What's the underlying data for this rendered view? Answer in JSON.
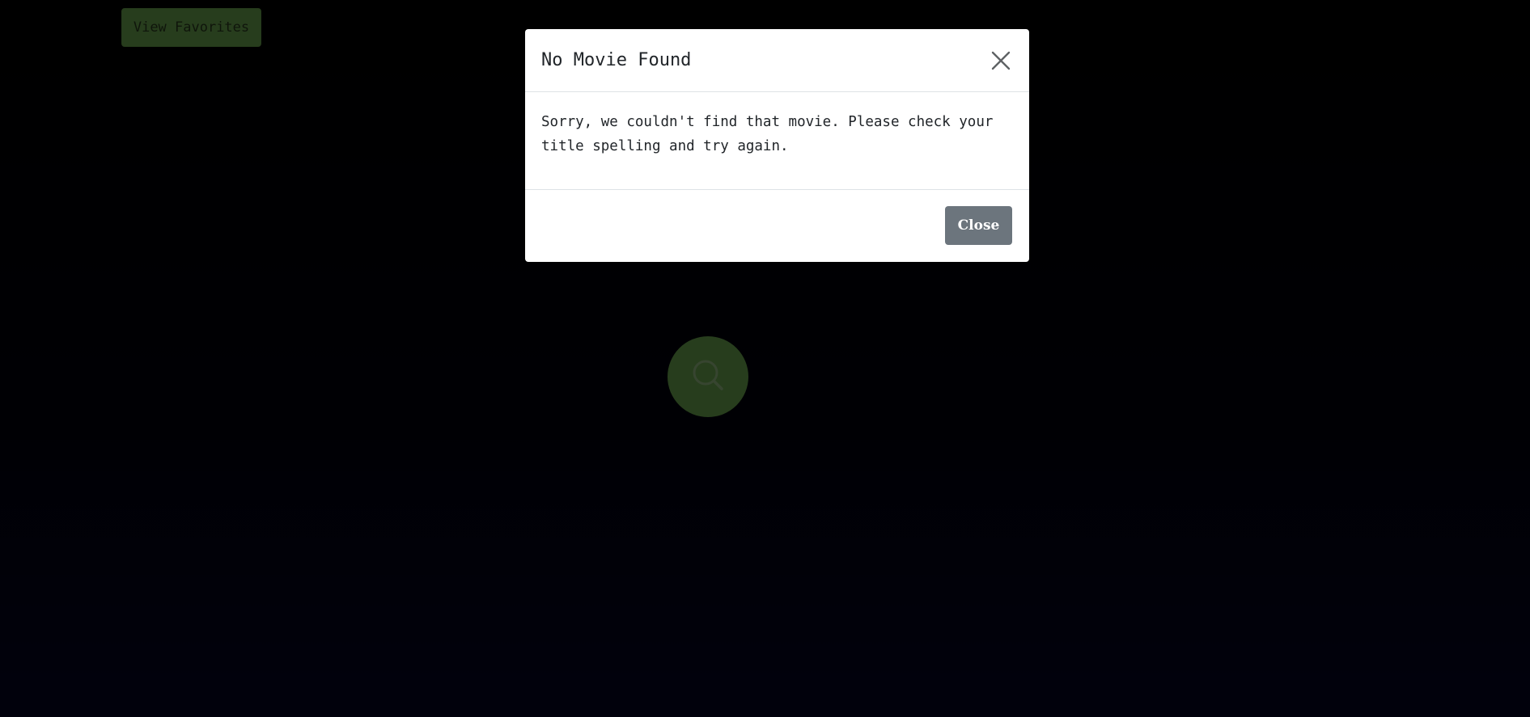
{
  "background_page": {
    "favorites_button_label": "View Favorites",
    "search_button_icon": "search-icon",
    "accent_color": "#4f7a3a"
  },
  "modal": {
    "title": "No Movie Found",
    "close_icon": "close-icon",
    "message": "Sorry, we couldn't find that movie. Please check your title spelling and try again.",
    "close_button_label": "Close",
    "close_button_color": "#6c757d"
  }
}
